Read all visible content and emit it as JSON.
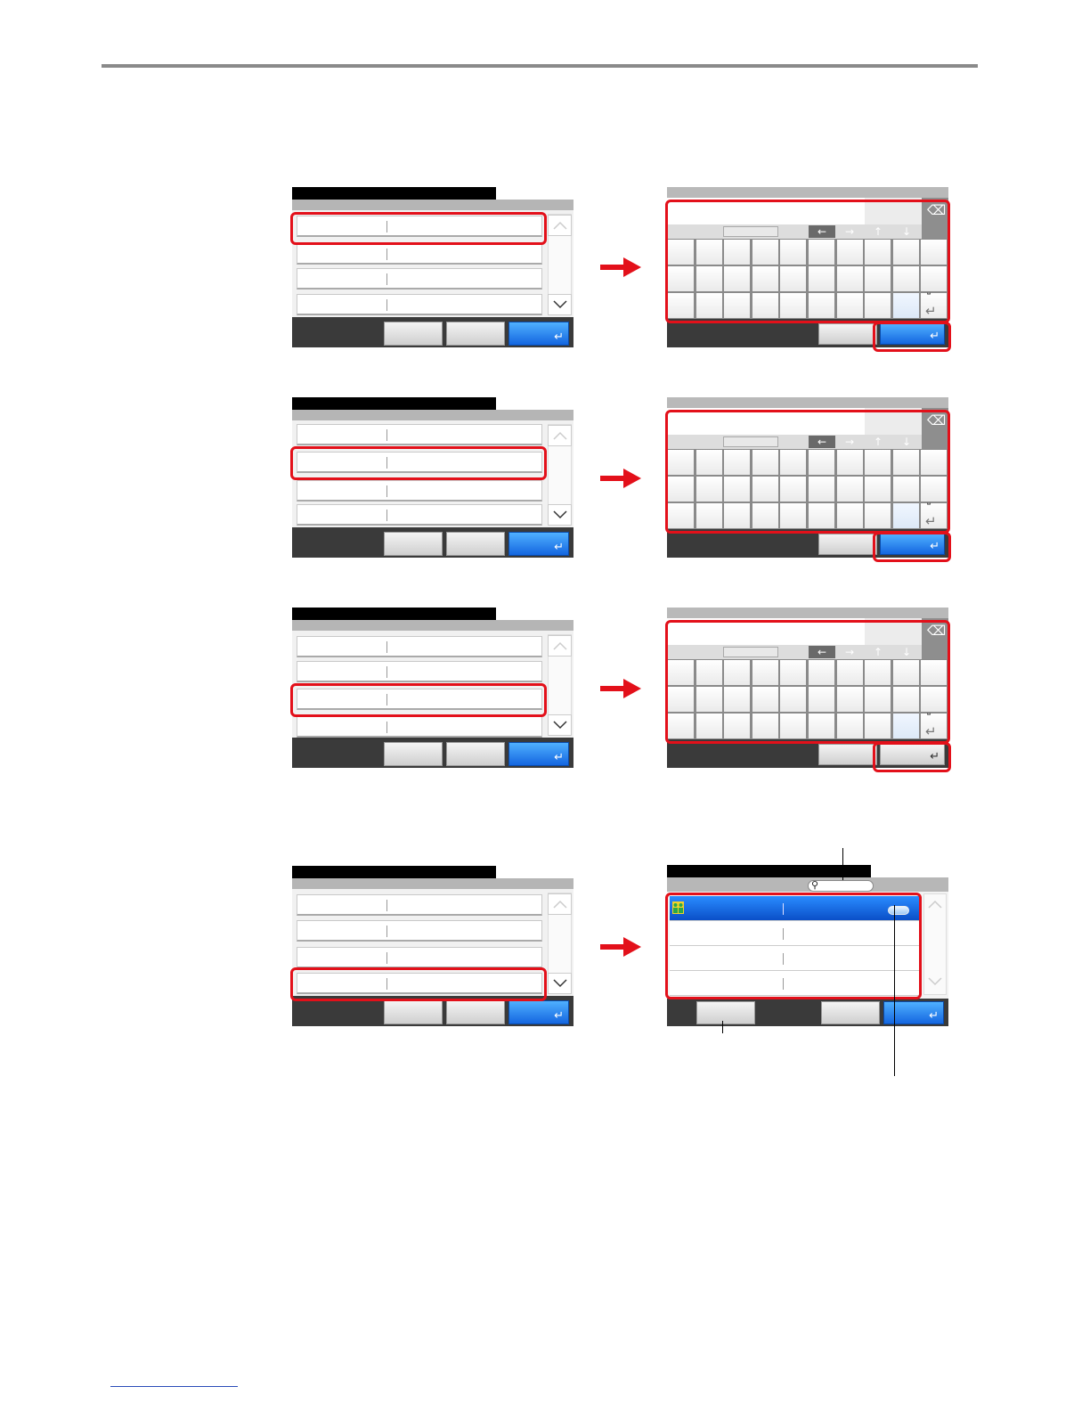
{
  "page": {
    "rule_color": "#8a8a8a",
    "highlight_color": "#e3101a",
    "arrow_color": "#e3101a",
    "accent_color": "#1466e0"
  },
  "steps": [
    {
      "left_screen": "field-list",
      "highlighted_row": 1,
      "right_screen": "keyboard",
      "ok_button_style": "blue"
    },
    {
      "left_screen": "field-list",
      "highlighted_row": 2,
      "right_screen": "keyboard",
      "ok_button_style": "blue"
    },
    {
      "left_screen": "field-list",
      "highlighted_row": 3,
      "right_screen": "keyboard",
      "ok_button_style": "grey"
    },
    {
      "left_screen": "field-list",
      "highlighted_row": 4,
      "right_screen": "address-book-list",
      "ok_button_style": "blue"
    }
  ],
  "icons": {
    "backspace": "backspace-icon",
    "left_arrow": "←",
    "right_arrow": "→",
    "up_arrow": "↑",
    "down_arrow": "↓",
    "space": "⎵",
    "enter": "↵",
    "search": "🔍"
  }
}
